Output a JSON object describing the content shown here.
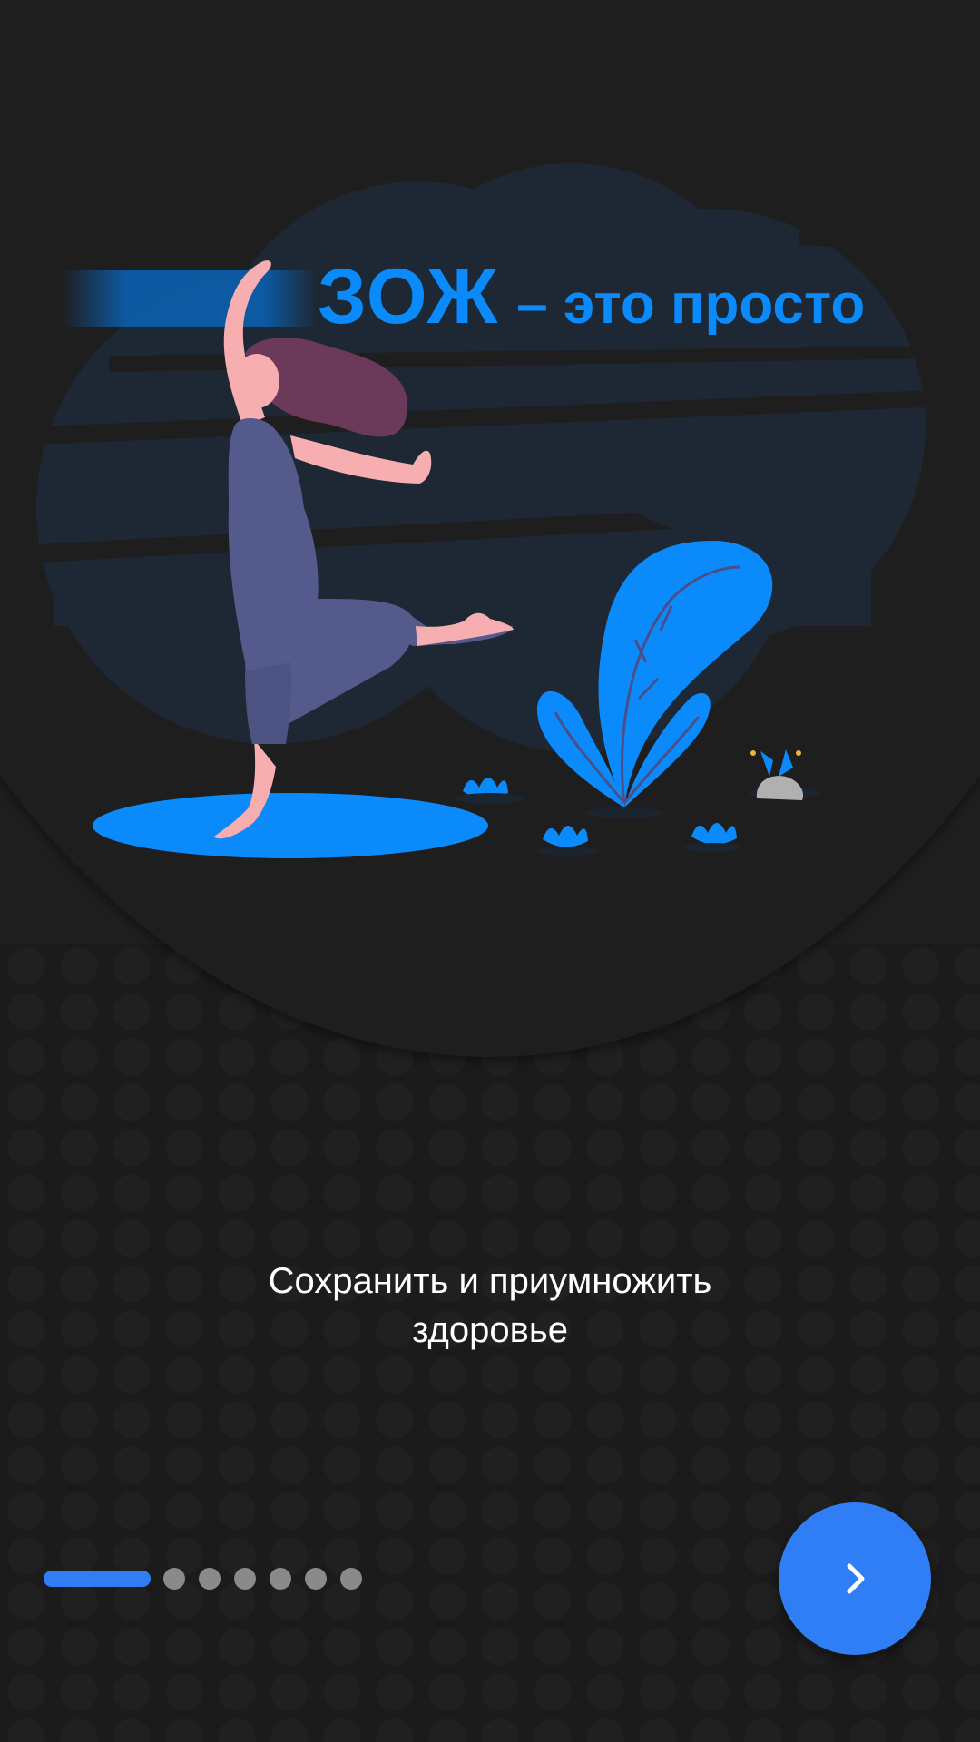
{
  "onboarding": {
    "headline_big": "ЗОЖ",
    "headline_small": "– это просто",
    "slogan_line1": "Сохранить и приумножить",
    "slogan_line2": "здоровье"
  },
  "pager": {
    "total_pages": 7,
    "current_page": 1
  },
  "next_button": {
    "icon": "chevron-right-icon"
  },
  "colors": {
    "accent": "#2f7ef5",
    "headline": "#0b8bfb",
    "background": "#1e1e1e",
    "dot_inactive": "#8a8a8a"
  }
}
